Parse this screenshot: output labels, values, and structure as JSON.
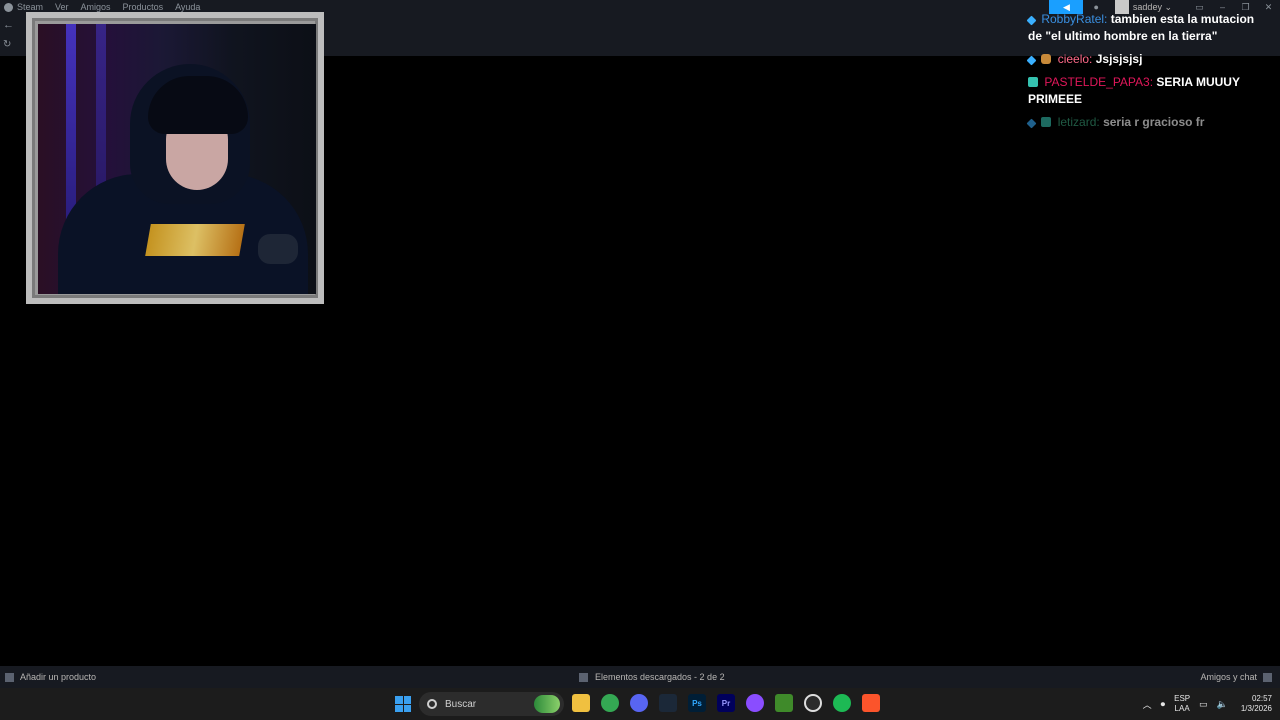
{
  "steam": {
    "menu": [
      "Steam",
      "Ver",
      "Amigos",
      "Productos",
      "Ayuda"
    ],
    "username": "saddey"
  },
  "chat": {
    "messages": [
      {
        "user": "RobbyRatel:",
        "text": "tambien esta la mutacion de \"el ultimo hombre en la tierra\"",
        "user_color": "#3a8fe0",
        "badges": [
          "pin"
        ]
      },
      {
        "user": "cieelo:",
        "text": "Jsjsjsjsj",
        "user_color": "#ff6a8a",
        "badges": [
          "pin",
          "bag"
        ]
      },
      {
        "user": "PASTELDE_PAPA3:",
        "text": "SERIA MUUUY PRIMEEE",
        "user_color": "#e0175a",
        "badges": [
          "grid"
        ]
      },
      {
        "user": "letizard:",
        "text": "seria r gracioso fr",
        "user_color": "#3aa37a",
        "badges": [
          "pin",
          "grid"
        ]
      }
    ]
  },
  "bottom_bar": {
    "add_product": "Añadir un producto",
    "downloads": "Elementos descargados - 2 de 2",
    "friends": "Amigos y chat"
  },
  "taskbar": {
    "search_placeholder": "Buscar",
    "apps": [
      {
        "name": "file-explorer",
        "label": "",
        "color": "#f0c040"
      },
      {
        "name": "chrome",
        "label": "",
        "color": "#34a853"
      },
      {
        "name": "discord",
        "label": "",
        "color": "#5865f2"
      },
      {
        "name": "steam",
        "label": "",
        "color": "#1b2838"
      },
      {
        "name": "photoshop",
        "label": "Ps",
        "color": "#001e36"
      },
      {
        "name": "premiere",
        "label": "Pr",
        "color": "#00005b"
      },
      {
        "name": "app-purple",
        "label": "",
        "color": "#8a4dff"
      },
      {
        "name": "minecraft",
        "label": "",
        "color": "#3f8a2a"
      },
      {
        "name": "obs",
        "label": "",
        "color": "#2b2b2b"
      },
      {
        "name": "spotify",
        "label": "",
        "color": "#1db954"
      },
      {
        "name": "brave",
        "label": "",
        "color": "#fb542b"
      }
    ],
    "lang_top": "ESP",
    "lang_bottom": "LAA",
    "time": "02:57",
    "date": "1/3/2026"
  }
}
